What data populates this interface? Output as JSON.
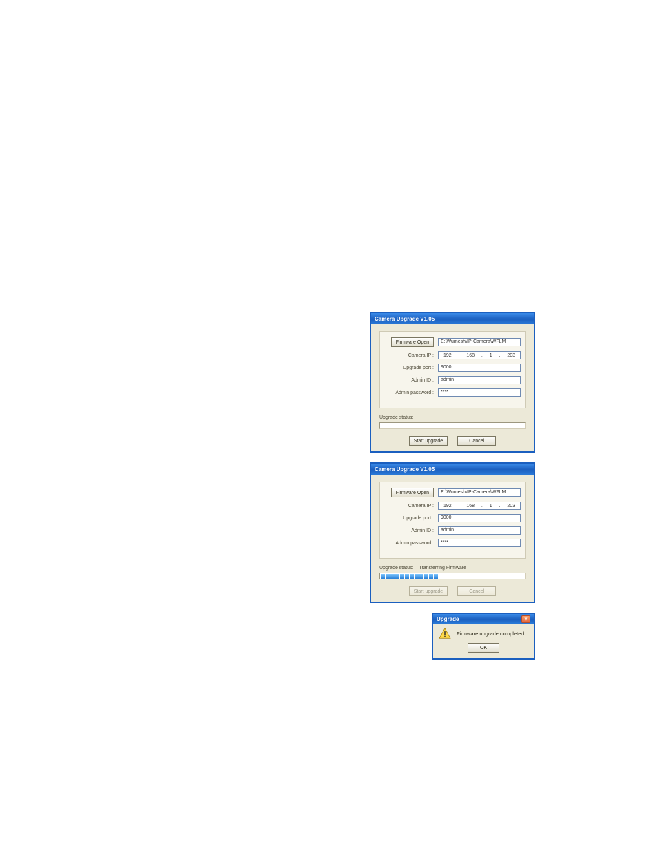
{
  "window1": {
    "title": "Camera Upgrade V1.05",
    "firmwareOpenLabel": "Firmware Open",
    "cameraIpLabel": "Camera IP :",
    "upgradePortLabel": "Upgrade port :",
    "adminIdLabel": "Admin ID :",
    "adminPasswordLabel": "Admin password :",
    "firmwarePath": "E:\\Wumesh\\IP-Camera\\WFLM",
    "ip": {
      "a": "192",
      "b": "168",
      "c": "1",
      "d": "203"
    },
    "port": "9000",
    "adminId": "admin",
    "adminPassword": "****",
    "statusLabel": "Upgrade status:",
    "statusText": "",
    "startBtn": "Start upgrade",
    "cancelBtn": "Cancel"
  },
  "window2": {
    "title": "Camera Upgrade V1.05",
    "firmwareOpenLabel": "Firmware Open",
    "cameraIpLabel": "Camera IP :",
    "upgradePortLabel": "Upgrade port :",
    "adminIdLabel": "Admin ID :",
    "adminPasswordLabel": "Admin password :",
    "firmwarePath": "E:\\Wumesh\\IP-Camera\\WFLM",
    "ip": {
      "a": "192",
      "b": "168",
      "c": "1",
      "d": "203"
    },
    "port": "9000",
    "adminId": "admin",
    "adminPassword": "****",
    "statusLabel": "Upgrade status:",
    "statusText": "Transferring Firmware",
    "progressSegments": 12,
    "progressFilled": 12,
    "startBtn": "Start upgrade",
    "cancelBtn": "Cancel"
  },
  "modal": {
    "title": "Upgrade",
    "message": "Firmware upgrade completed.",
    "ok": "OK"
  }
}
